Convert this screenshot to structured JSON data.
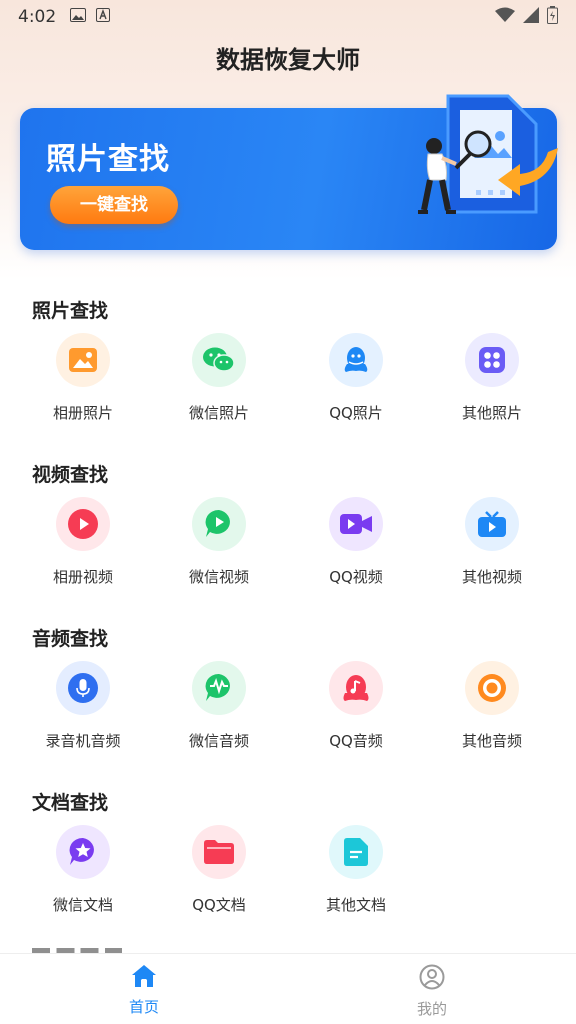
{
  "status_bar": {
    "time": "4:02"
  },
  "app": {
    "title": "数据恢复大师"
  },
  "banner": {
    "title": "照片查找",
    "button_label": "一键查找"
  },
  "sections": [
    {
      "title": "照片查找",
      "items": [
        {
          "label": "相册照片",
          "icon": "photo-album-icon",
          "color": "#ff8a1f"
        },
        {
          "label": "微信照片",
          "icon": "wechat-icon",
          "color": "#1dc46a"
        },
        {
          "label": "QQ照片",
          "icon": "qq-icon",
          "color": "#1e88f5"
        },
        {
          "label": "其他照片",
          "icon": "grid-apps-icon",
          "color": "#6a5cf5"
        }
      ]
    },
    {
      "title": "视频查找",
      "items": [
        {
          "label": "相册视频",
          "icon": "play-icon",
          "color": "#f63c54"
        },
        {
          "label": "微信视频",
          "icon": "wechat-video-icon",
          "color": "#1dc46a"
        },
        {
          "label": "QQ视频",
          "icon": "video-camera-icon",
          "color": "#7a3cf0"
        },
        {
          "label": "其他视频",
          "icon": "tv-icon",
          "color": "#1e88f5"
        }
      ]
    },
    {
      "title": "音频查找",
      "items": [
        {
          "label": "录音机音频",
          "icon": "microphone-icon",
          "color": "#2f6ff0"
        },
        {
          "label": "微信音频",
          "icon": "waveform-icon",
          "color": "#1dc46a"
        },
        {
          "label": "QQ音频",
          "icon": "music-note-icon",
          "color": "#f63c54"
        },
        {
          "label": "其他音频",
          "icon": "record-icon",
          "color": "#ff8a1f"
        }
      ]
    },
    {
      "title": "文档查找",
      "items": [
        {
          "label": "微信文档",
          "icon": "star-chat-icon",
          "color": "#7a3cf0"
        },
        {
          "label": "QQ文档",
          "icon": "folder-icon",
          "color": "#f63c54"
        },
        {
          "label": "其他文档",
          "icon": "document-icon",
          "color": "#1cc7d8"
        }
      ]
    }
  ],
  "bottom_nav": [
    {
      "label": "首页",
      "icon": "home-icon",
      "active": true,
      "color": "#1e88f5"
    },
    {
      "label": "我的",
      "icon": "profile-icon",
      "active": false,
      "color": "#9a9a9a"
    }
  ]
}
